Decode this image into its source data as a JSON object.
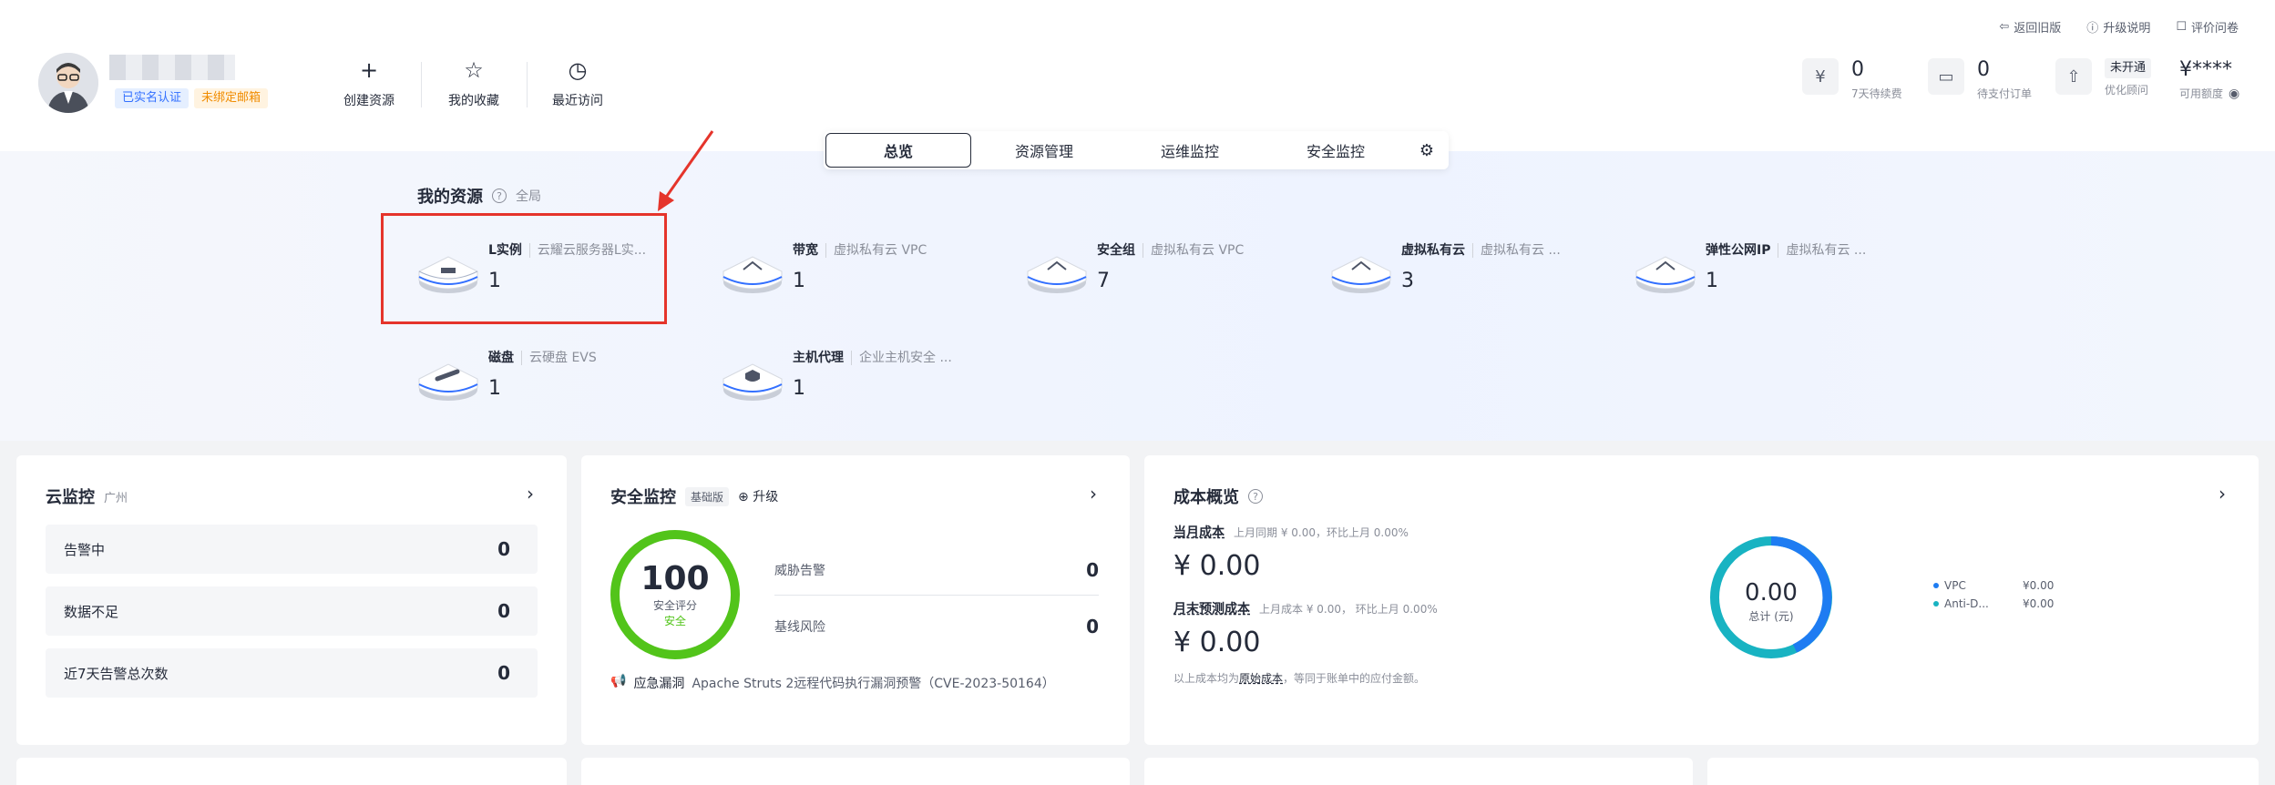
{
  "header": {
    "top_links": [
      {
        "icon": "return-icon",
        "label": "返回旧版"
      },
      {
        "icon": "help-circle-icon",
        "label": "升级说明"
      },
      {
        "icon": "survey-icon",
        "label": "评价问卷"
      }
    ],
    "badges": {
      "verified": "已实名认证",
      "email": "未绑定邮箱"
    },
    "quick_actions": [
      {
        "icon": "plus-icon",
        "label": "创建资源"
      },
      {
        "icon": "star-icon",
        "label": "我的收藏"
      },
      {
        "icon": "clock-icon",
        "label": "最近访问"
      }
    ],
    "finance": [
      {
        "icon": "yen-icon",
        "value": "0",
        "label": "7天待续费"
      },
      {
        "icon": "card-icon",
        "value": "0",
        "label": "待支付订单"
      },
      {
        "icon": "rocket-icon",
        "value": "未开通",
        "label": "优化顾问"
      },
      {
        "icon": "eye-icon",
        "value": "¥****",
        "label": "可用额度"
      }
    ]
  },
  "tabs": [
    "总览",
    "资源管理",
    "运维监控",
    "安全监控"
  ],
  "resources": {
    "title": "我的资源",
    "scope": "全局",
    "items": [
      {
        "name": "L实例",
        "sub": "云耀云服务器L实...",
        "count": "1"
      },
      {
        "name": "带宽",
        "sub": "虚拟私有云 VPC",
        "count": "1"
      },
      {
        "name": "安全组",
        "sub": "虚拟私有云 VPC",
        "count": "7"
      },
      {
        "name": "虚拟私有云",
        "sub": "虚拟私有云 ...",
        "count": "3"
      },
      {
        "name": "弹性公网IP",
        "sub": "虚拟私有云 ...",
        "count": "1"
      },
      {
        "name": "磁盘",
        "sub": "云硬盘 EVS",
        "count": "1"
      },
      {
        "name": "主机代理",
        "sub": "企业主机安全 ...",
        "count": "1"
      }
    ]
  },
  "cloud_monitor": {
    "title": "云监控",
    "region": "广州",
    "rows": [
      {
        "label": "告警中",
        "value": "0"
      },
      {
        "label": "数据不足",
        "value": "0"
      },
      {
        "label": "近7天告警总次数",
        "value": "0"
      }
    ]
  },
  "security": {
    "title": "安全监控",
    "tag": "基础版",
    "upgrade": "升级",
    "score": "100",
    "score_label": "安全评分",
    "score_status": "安全",
    "rows": [
      {
        "label": "威胁告警",
        "value": "0"
      },
      {
        "label": "基线风险",
        "value": "0"
      }
    ],
    "vuln_label": "应急漏洞",
    "vuln_text": "Apache Struts 2远程代码执行漏洞预警（CVE-2023-50164）"
  },
  "cost": {
    "title": "成本概览",
    "month_label": "当月成本",
    "month_cmp": "上月同期 ¥ 0.00，环比上月  0.00%",
    "month_value": "¥ 0.00",
    "forecast_label": "月末预测成本",
    "forecast_cmp": "上月成本 ¥ 0.00，  环比上月  0.00%",
    "forecast_value": "¥ 0.00",
    "note_prefix": "以上成本均为",
    "note_link": "原始成本",
    "note_suffix": "，等同于账单中的应付金额。",
    "total_value": "0.00",
    "total_label": "总计 (元)",
    "legend": [
      {
        "name": "VPC",
        "value": "¥0.00",
        "color": "#1e7cf2"
      },
      {
        "name": "Anti-D...",
        "value": "¥0.00",
        "color": "#18b3c2"
      }
    ]
  }
}
